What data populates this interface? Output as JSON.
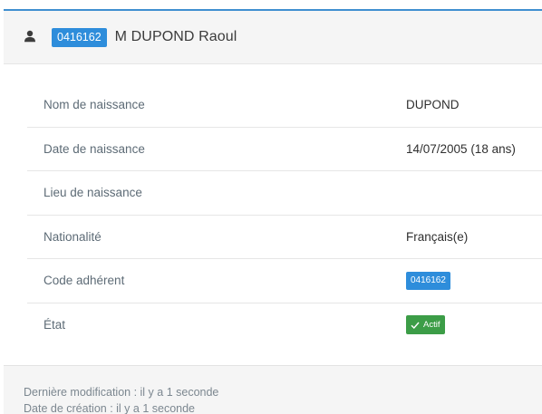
{
  "header": {
    "icon": "person-icon",
    "code": "0416162",
    "name": "M DUPOND Raoul"
  },
  "details": {
    "rows": [
      {
        "label": "Nom de naissance",
        "value": "DUPOND"
      },
      {
        "label": "Date de naissance",
        "value": "14/07/2005 (18 ans)"
      },
      {
        "label": "Lieu de naissance",
        "value": ""
      },
      {
        "label": "Nationalité",
        "value": "Français(e)"
      },
      {
        "label": "Code adhérent",
        "value": "0416162"
      },
      {
        "label": "État",
        "value": "Actif",
        "icon": "checkmark-icon"
      }
    ]
  },
  "footer": {
    "modified": "Dernière modification :  il y a 1 seconde",
    "created": "Date de création : il y a 1 seconde"
  },
  "colors": {
    "accent": "#3f8fd0",
    "badge_blue": "#2e8ddb",
    "status_green": "#3c9d47"
  }
}
